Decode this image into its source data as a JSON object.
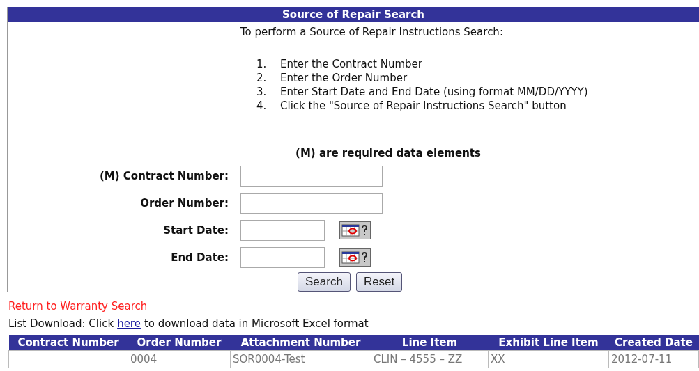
{
  "title": "Source of Repair Search",
  "intro": "To perform a Source of Repair Instructions Search:",
  "steps": [
    {
      "number": "1.",
      "text": "Enter the Contract Number"
    },
    {
      "number": "2.",
      "text": "Enter the Order Number"
    },
    {
      "number": "3.",
      "text": "Enter Start Date and End Date (using format MM/DD/YYYY)"
    },
    {
      "number": "4.",
      "text": "Click the \"Source of Repair Instructions Search\" button"
    }
  ],
  "required_note": "(M) are required data elements",
  "fields": [
    {
      "label": "(M) Contract Number:",
      "kind": "text"
    },
    {
      "label": "Order Number:",
      "kind": "text"
    },
    {
      "label": "Start Date:",
      "kind": "date"
    },
    {
      "label": "End Date:",
      "kind": "date"
    }
  ],
  "buttons": [
    "Search",
    "Reset"
  ],
  "return_link": "Return to Warranty Search",
  "download": {
    "before": "List Download: Click",
    "link": "here",
    "after": "to download data in Microsoft Excel format"
  },
  "table": {
    "columns": [
      "Contract Number",
      "Order Number",
      "Attachment Number",
      "Line Item",
      "Exhibit Line Item",
      "Created Date"
    ],
    "rows": [
      [
        "",
        "0004",
        "SOR0004-Test",
        "CLIN – 4555 – ZZ",
        "XX",
        "2012-07-11"
      ]
    ]
  }
}
